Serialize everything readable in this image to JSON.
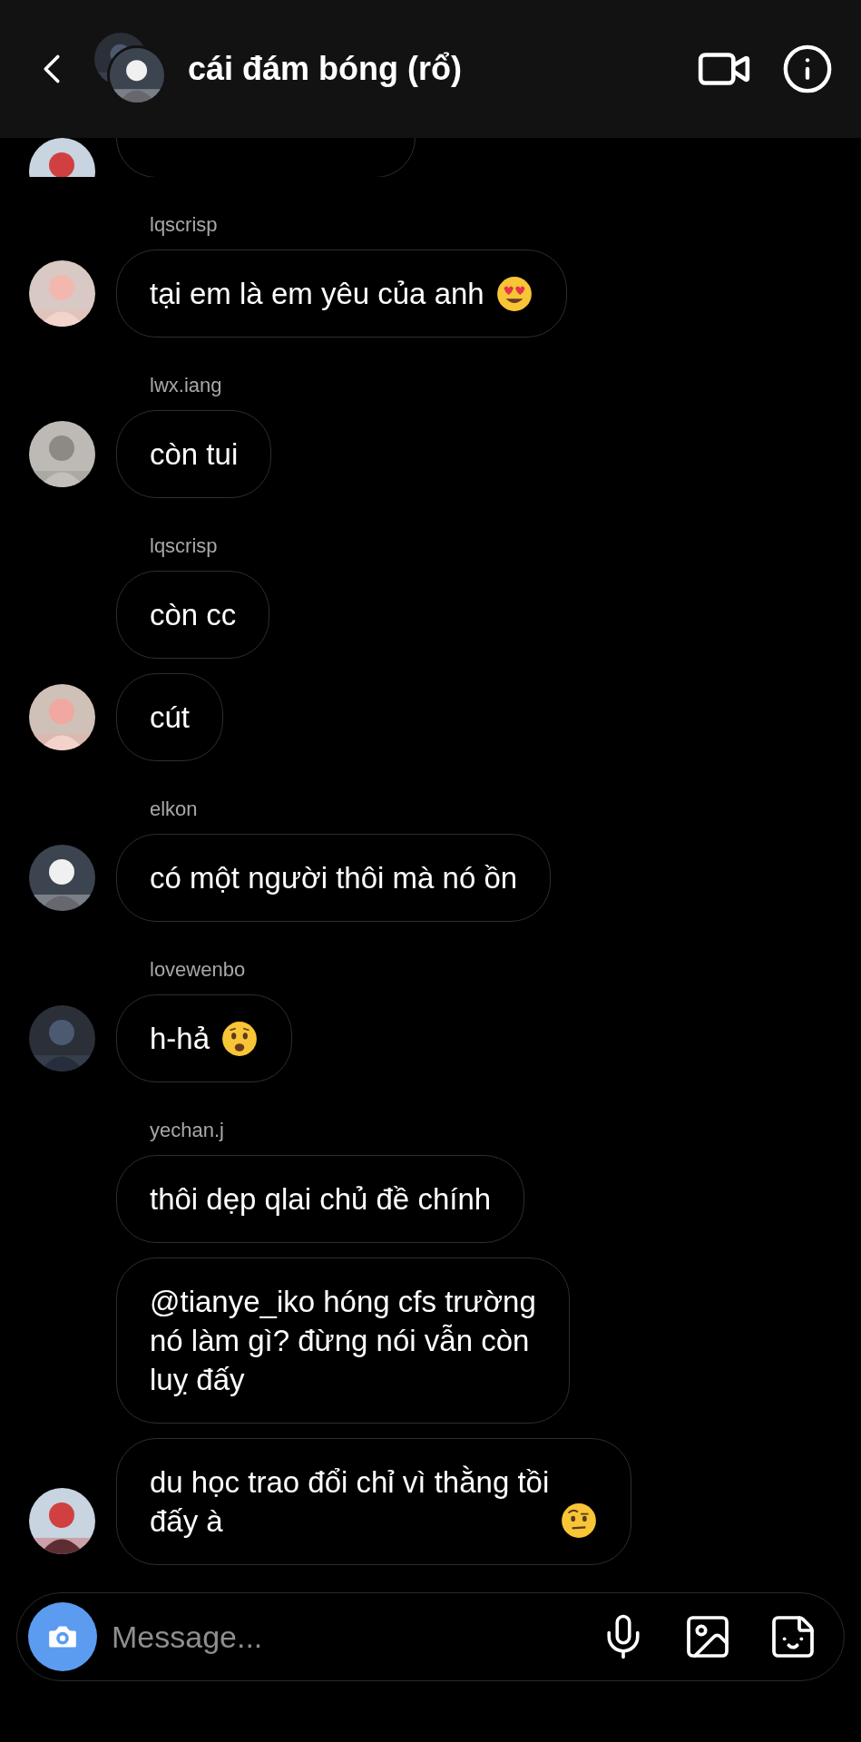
{
  "header": {
    "title": "cái đám bóng (rổ)"
  },
  "messages": [
    {
      "sender": "lqscrisp",
      "avatar": true,
      "text": "tại em là em yêu của anh",
      "kind": "hearteyes"
    },
    {
      "sender": "lwx.iang",
      "avatar": true,
      "text": "còn tui"
    },
    {
      "sender": "lqscrisp",
      "avatar": false,
      "text": "còn cc"
    },
    {
      "avatar": true,
      "text": "cút"
    },
    {
      "sender": "elkon",
      "avatar": true,
      "text": "có một người thôi mà nó ồn"
    },
    {
      "sender": "lovewenbo",
      "avatar": true,
      "text": "h-hả",
      "kind": "anguished"
    },
    {
      "sender": "yechan.j",
      "avatar": false,
      "text": "thôi dẹp qlai chủ đề chính"
    },
    {
      "avatar": false,
      "text": "@tianye_iko hóng cfs trường\nnó làm gì? đừng nói vẫn còn\nluỵ đấy"
    },
    {
      "avatar": true,
      "text": "du học trao đổi chỉ vì thằng tồi\nđấy à",
      "kind": "eyebrow"
    }
  ],
  "composer": {
    "placeholder": "Message..."
  }
}
